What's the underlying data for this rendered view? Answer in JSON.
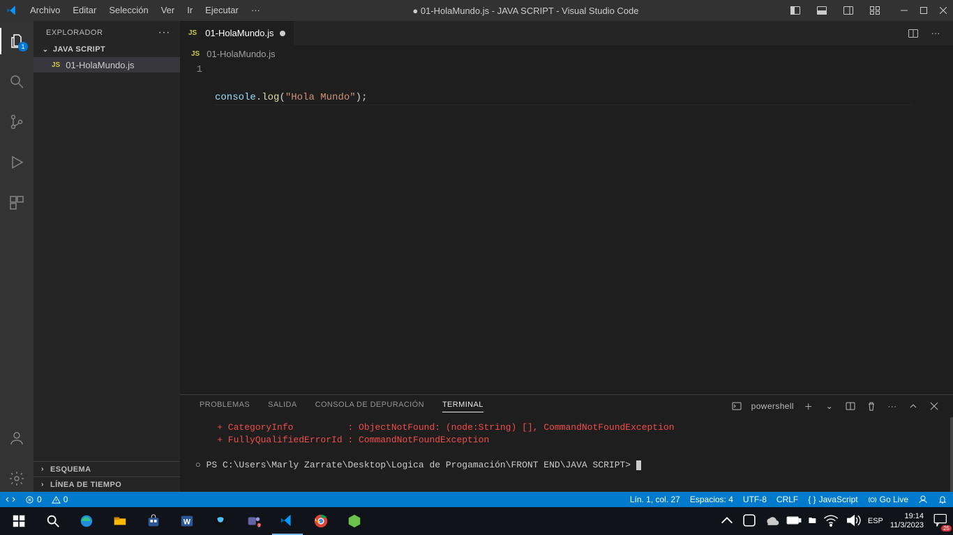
{
  "menu": {
    "archivo": "Archivo",
    "editar": "Editar",
    "seleccion": "Selección",
    "ver": "Ver",
    "ir": "Ir",
    "ejecutar": "Ejecutar",
    "mas": "···"
  },
  "title": "● 01-HolaMundo.js - JAVA SCRIPT - Visual Studio Code",
  "explorer": {
    "header": "EXPLORADOR",
    "folder": "JAVA SCRIPT",
    "file1": "01-HolaMundo.js",
    "esquema": "ESQUEMA",
    "linea": "LÍNEA DE TIEMPO",
    "badge": "1"
  },
  "tab": {
    "label": "01-HolaMundo.js"
  },
  "breadcrumb": {
    "file": "01-HolaMundo.js"
  },
  "code": {
    "line1_num": "1",
    "obj": "console",
    "dot": ".",
    "fn": "log",
    "open": "(",
    "q1": "\"",
    "str": "Hola Mundo",
    "q2": "\"",
    "close": ");"
  },
  "panel": {
    "problemas": "PROBLEMAS",
    "salida": "SALIDA",
    "consola": "CONSOLA DE DEPURACIÓN",
    "terminal": "TERMINAL",
    "shell": "powershell"
  },
  "terminal": {
    "l1": "    + CategoryInfo          : ObjectNotFound: (node:String) [], CommandNotFoundException",
    "l2": "    + FullyQualifiedErrorId : CommandNotFoundException",
    "prompt_circle": "○",
    "prompt": " PS C:\\Users\\Marly Zarrate\\Desktop\\Logica de Progamación\\FRONT END\\JAVA SCRIPT> "
  },
  "status": {
    "errors": "0",
    "warnings": "0",
    "ln": "Lín. 1, col. 27",
    "spaces": "Espacios: 4",
    "encoding": "UTF-8",
    "eol": "CRLF",
    "lang": "JavaScript",
    "golive": "Go Live"
  },
  "tray": {
    "lang": "ESP",
    "time": "19:14",
    "date": "11/3/2023",
    "badge": "25"
  }
}
